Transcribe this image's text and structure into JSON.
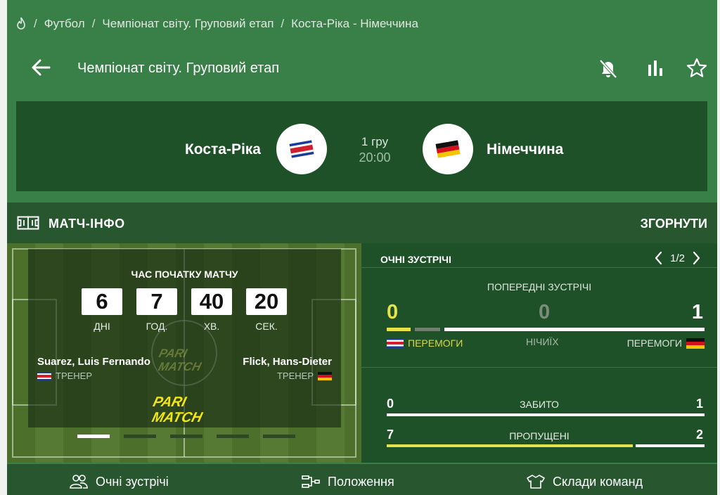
{
  "breadcrumb": {
    "items": [
      "Футбол",
      "Чемпіонат світу. Груповий етап",
      "Коста-Ріка - Німеччина"
    ],
    "separator": "/"
  },
  "header": {
    "title": "Чемпіонат світу. Груповий етап",
    "icons": [
      "arrow-left-icon",
      "bell-off-icon",
      "bar-chart-icon",
      "star-icon"
    ]
  },
  "match": {
    "home_team": "Коста-Ріка",
    "away_team": "Німеччина",
    "round": "1 гру",
    "time": "20:00"
  },
  "info_bar": {
    "label": "МАТЧ-ІНФО",
    "collapse": "ЗГОРНУТИ"
  },
  "countdown": {
    "title": "ЧАС ПОЧАТКУ МАТЧУ",
    "days": "6",
    "hours": "7",
    "minutes": "40",
    "seconds": "20",
    "days_label": "ДНІ",
    "hours_label": "ГОД.",
    "minutes_label": "ХВ.",
    "seconds_label": "СЕК."
  },
  "coaches": {
    "home_name": "Suarez, Luis Fernando",
    "away_name": "Flick, Hans-Dieter",
    "role": "ТРЕНЕР"
  },
  "brand": {
    "logo_text_1": "PARI",
    "logo_text_2": "MATCH",
    "logo_color": "#f4e616"
  },
  "carousel": {
    "count": 5,
    "active": 0
  },
  "h2h": {
    "title": "ОЧНІ ЗУСТРІЧІ",
    "page": "1/2",
    "prev_title": "ПОПЕРЕДНІ ЗУСТРІЧІ",
    "home_wins": "0",
    "draws": "0",
    "away_wins": "1",
    "wins_label": "ПЕРЕМОГИ",
    "draws_label": "НІЧИЇХ",
    "scored_label": "ЗАБИТО",
    "scored_home": "0",
    "scored_away": "1",
    "conceded_label": "ПРОПУЩЕНІ",
    "conceded_home": "7",
    "conceded_away": "2"
  },
  "tabs": [
    {
      "label": "Очні зустрічі",
      "icon": "people-icon"
    },
    {
      "label": "Положення",
      "icon": "bracket-icon"
    },
    {
      "label": "Склади команд",
      "icon": "shirt-icon"
    }
  ],
  "colors": {
    "background": "#397f48",
    "panel": "#1f5128",
    "bar_dark": "#27562f",
    "accent_yellow": "#e6e24a",
    "neutral_gray": "#6f7f70"
  }
}
